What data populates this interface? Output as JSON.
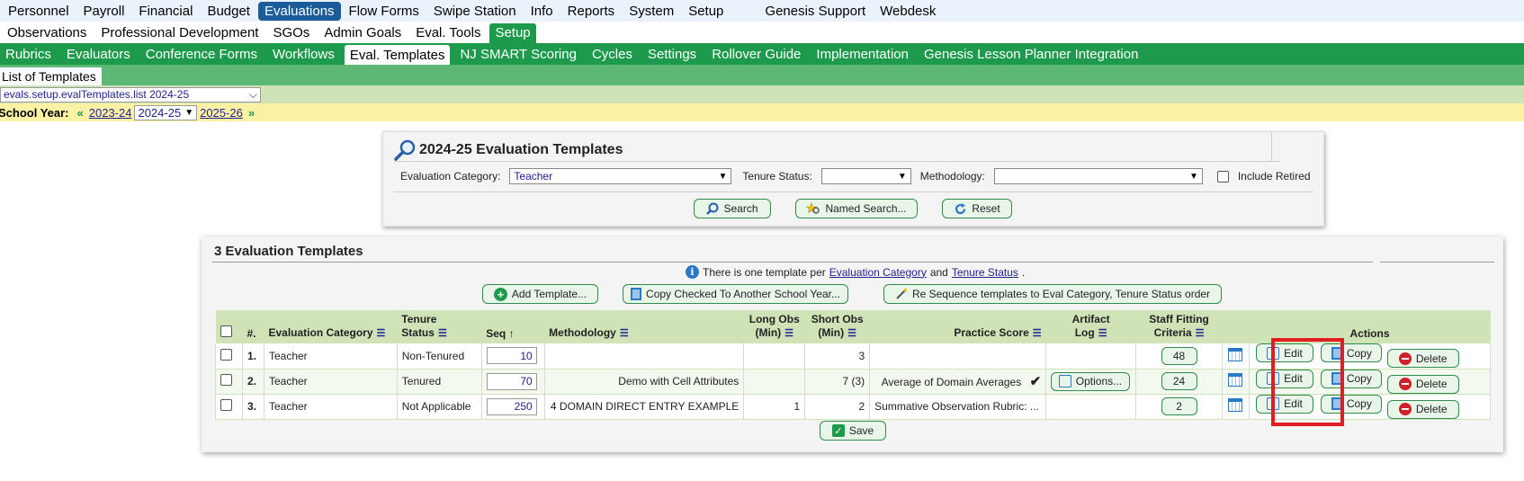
{
  "top_nav": [
    "Personnel",
    "Payroll",
    "Financial",
    "Budget",
    "Evaluations",
    "Flow Forms",
    "Swipe Station",
    "Info",
    "Reports",
    "System",
    "Setup"
  ],
  "top_nav_active": "Evaluations",
  "top_nav_extra": [
    "Genesis Support",
    "Webdesk"
  ],
  "sub_nav": [
    "Observations",
    "Professional Development",
    "SGOs",
    "Admin Goals",
    "Eval. Tools",
    "Setup"
  ],
  "sub_nav_active": "Setup",
  "green_nav": [
    "Rubrics",
    "Evaluators",
    "Conference Forms",
    "Workflows",
    "Eval. Templates",
    "NJ SMART Scoring",
    "Cycles",
    "Settings",
    "Rollover Guide",
    "Implementation",
    "Genesis Lesson Planner Integration"
  ],
  "green_nav_active": "Eval. Templates",
  "page_tab": "List of Templates",
  "path_select": "evals.setup.evalTemplates.list 2024-25",
  "school_year": {
    "label": "School Year:",
    "prev": "2023-24",
    "current": "2024-25",
    "next": "2025-26"
  },
  "search": {
    "title": "2024-25 Evaluation Templates",
    "eval_category_label": "Evaluation Category:",
    "eval_category_value": "Teacher",
    "tenure_label": "Tenure Status:",
    "tenure_value": "",
    "methodology_label": "Methodology:",
    "methodology_value": "",
    "include_retired": "Include Retired",
    "search_btn": "Search",
    "named_search_btn": "Named Search...",
    "reset_btn": "Reset"
  },
  "results": {
    "title": "3 Evaluation Templates",
    "info_prefix": "There is one template per",
    "info_link1": "Evaluation Category",
    "info_and": "and",
    "info_link2": "Tenure Status",
    "info_suffix": ".",
    "add_btn": "Add Template...",
    "copy_checked_btn": "Copy Checked To Another School Year...",
    "resequence_btn": "Re Sequence templates to Eval Category, Tenure Status order",
    "save_btn": "Save"
  },
  "columns": {
    "num": "#.",
    "category": "Evaluation Category",
    "tenure_1": "Tenure",
    "tenure_2": "Status",
    "seq": "Seq",
    "methodology": "Methodology",
    "long_obs_1": "Long Obs",
    "long_obs_2": "(Min)",
    "short_obs_1": "Short Obs",
    "short_obs_2": "(Min)",
    "practice": "Practice Score",
    "artifact_1": "Artifact",
    "artifact_2": "Log",
    "staff_1": "Staff Fitting",
    "staff_2": "Criteria",
    "actions": "Actions"
  },
  "rows": [
    {
      "num": "1.",
      "category": "Teacher",
      "tenure": "Non-Tenured",
      "seq": "10",
      "methodology": "",
      "long_obs": "",
      "short_obs": "3",
      "practice": "",
      "artifact": "",
      "staff": "48",
      "edit": "Edit",
      "copy": "Copy",
      "delete": "Delete"
    },
    {
      "num": "2.",
      "category": "Teacher",
      "tenure": "Tenured",
      "seq": "70",
      "methodology": "Demo with Cell Attributes",
      "long_obs": "",
      "short_obs": "7 (3)",
      "practice": "Average of Domain Averages",
      "artifact": "Options...",
      "staff": "24",
      "edit": "Edit",
      "copy": "Copy",
      "delete": "Delete"
    },
    {
      "num": "3.",
      "category": "Teacher",
      "tenure": "Not Applicable",
      "seq": "250",
      "methodology": "4 DOMAIN DIRECT ENTRY EXAMPLE",
      "long_obs": "1",
      "short_obs": "2",
      "practice": "Summative Observation Rubric: ...",
      "artifact": "",
      "staff": "2",
      "edit": "Edit",
      "copy": "Copy",
      "delete": "Delete"
    }
  ],
  "colors": {
    "nav_blue": "#1c5c9a",
    "green": "#1e9a4c",
    "header_green": "#cfe3b6",
    "year_bar": "#fbf2a6",
    "highlight_red": "#e31b23"
  }
}
